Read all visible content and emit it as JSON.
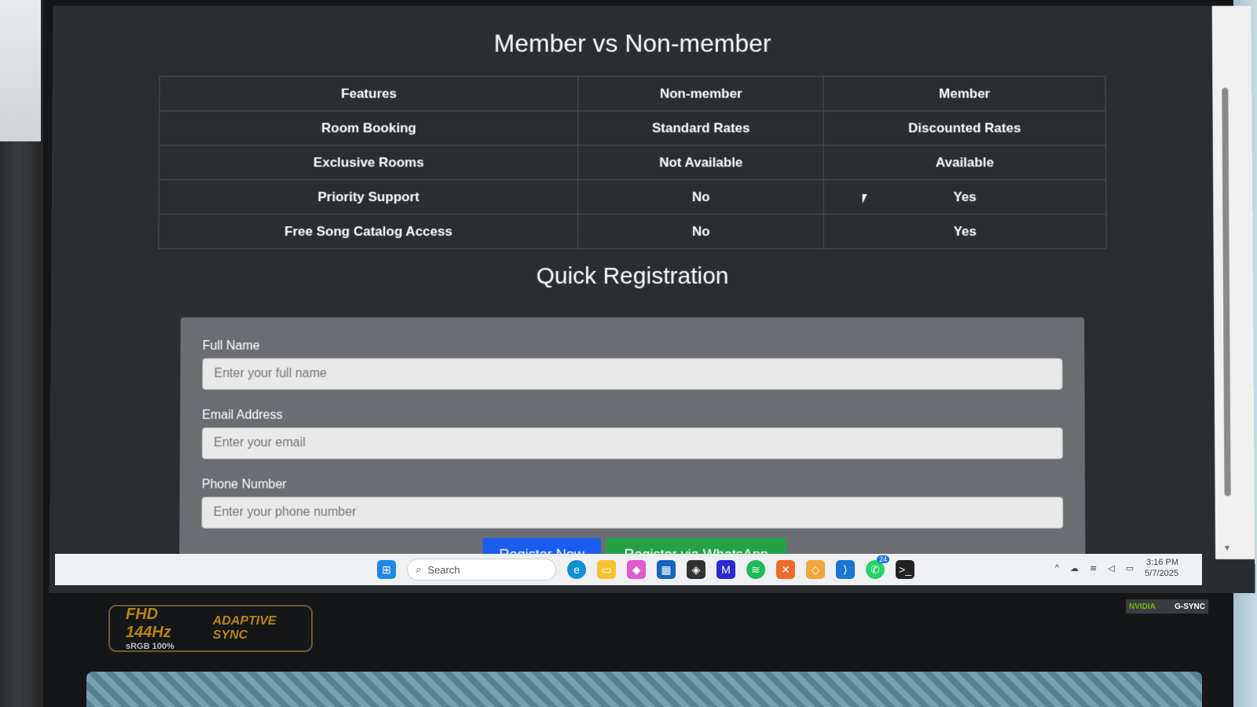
{
  "page": {
    "title": "Member vs Non-member",
    "registration_title": "Quick Registration"
  },
  "table": {
    "headers": [
      "Features",
      "Non-member",
      "Member"
    ],
    "rows": [
      [
        "Room Booking",
        "Standard Rates",
        "Discounted Rates"
      ],
      [
        "Exclusive Rooms",
        "Not Available",
        "Available"
      ],
      [
        "Priority Support",
        "No",
        "Yes"
      ],
      [
        "Free Song Catalog Access",
        "No",
        "Yes"
      ]
    ]
  },
  "form": {
    "full_name_label": "Full Name",
    "full_name_placeholder": "Enter your full name",
    "email_label": "Email Address",
    "email_placeholder": "Enter your email",
    "phone_label": "Phone Number",
    "phone_placeholder": "Enter your phone number",
    "register_button": "Register Now",
    "whatsapp_button": "Register via WhatsApp"
  },
  "taskbar": {
    "search_placeholder": "Search",
    "time": "3:16 PM",
    "date": "5/7/2025",
    "whatsapp_badge": "24",
    "icons": [
      "windows-start-icon",
      "search-icon",
      "edge-icon",
      "file-explorer-icon",
      "copilot-icon",
      "store-icon",
      "unity-icon",
      "app-icon",
      "spotify-icon",
      "xampp-icon",
      "app2-icon",
      "vscode-icon",
      "whatsapp-icon",
      "terminal-icon"
    ]
  },
  "laptop": {
    "sticker_main": "FHD 144Hz",
    "sticker_sub": "sRGB 100%",
    "sticker_sync": "ADAPTIVE SYNC",
    "nvidia_label": "NVIDIA",
    "gsync_label": "G-SYNC"
  },
  "colors": {
    "page_bg": "#2b2e31",
    "form_bg": "#6a6e73",
    "register_blue": "#1a5cf0",
    "whatsapp_green": "#25a046"
  }
}
